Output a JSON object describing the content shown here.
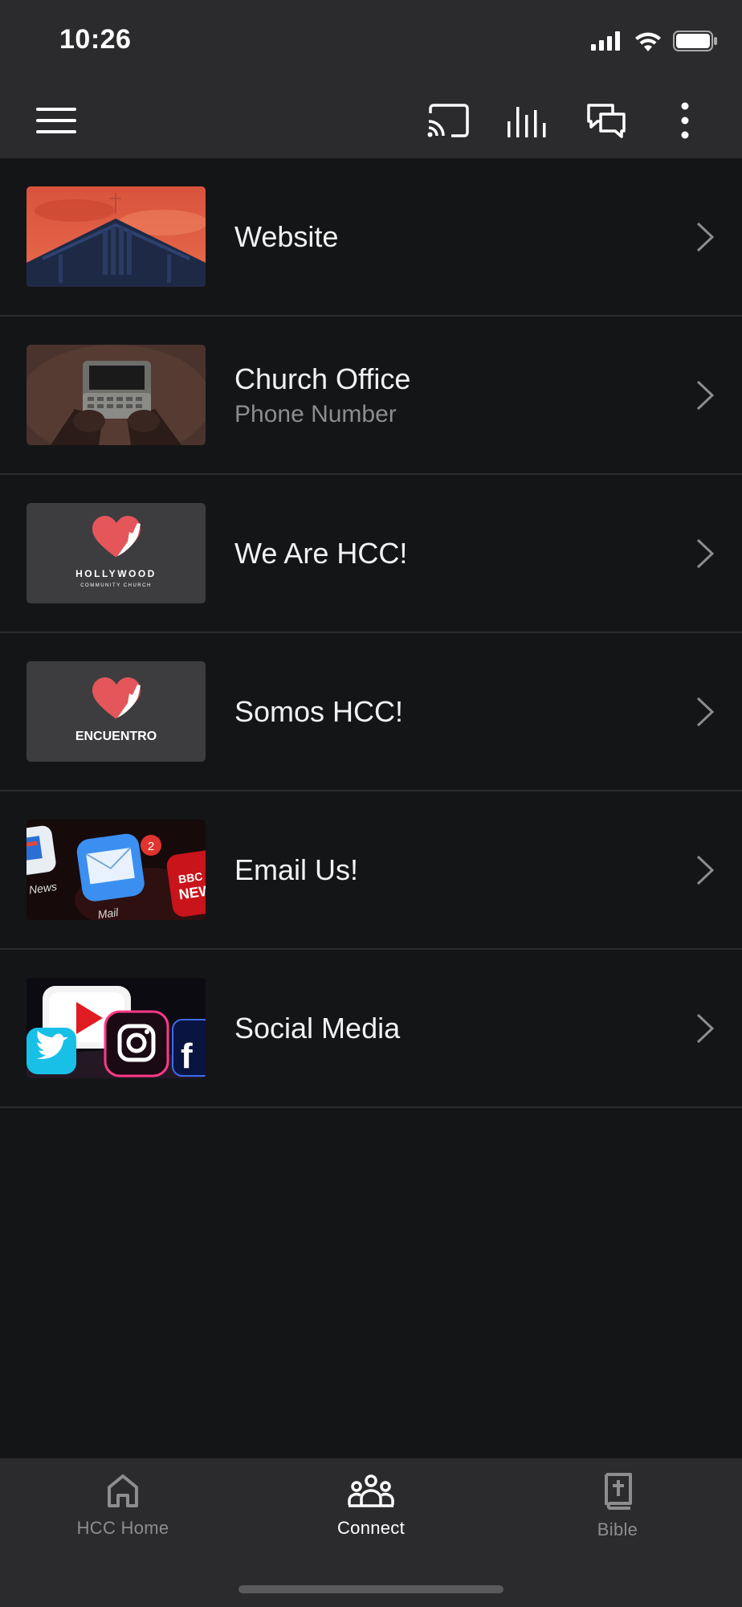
{
  "status_bar": {
    "time": "10:26"
  },
  "toolbar": {
    "menu_icon": "hamburger-icon",
    "cast_icon": "cast-icon",
    "audio_icon": "equalizer-icon",
    "chat_icon": "chat-icon",
    "more_icon": "more-vertical-icon"
  },
  "list": {
    "items": [
      {
        "title": "Website",
        "subtitle": "",
        "thumbnail": "church-building-sunset"
      },
      {
        "title": "Church Office",
        "subtitle": "Phone Number",
        "thumbnail": "hands-holding-phone"
      },
      {
        "title": "We Are HCC!",
        "subtitle": "",
        "thumbnail": "hollywood-community-church-logo",
        "logo_text": "HOLLYWOOD",
        "logo_subtext": "COMMUNITY CHURCH"
      },
      {
        "title": "Somos HCC!",
        "subtitle": "",
        "thumbnail": "encuentro-logo",
        "logo_text": "ENCUENTRO"
      },
      {
        "title": "Email Us!",
        "subtitle": "",
        "thumbnail": "mail-app-icons",
        "mail_badge": "2",
        "news_label": "News",
        "mail_label": "Mail",
        "bbc_label": "BBC",
        "bbc_news": "NEW"
      },
      {
        "title": "Social Media",
        "subtitle": "",
        "thumbnail": "social-media-icons"
      }
    ]
  },
  "bottom_nav": {
    "items": [
      {
        "label": "HCC Home",
        "icon": "home-icon",
        "active": false
      },
      {
        "label": "Connect",
        "icon": "people-icon",
        "active": true
      },
      {
        "label": "Bible",
        "icon": "bible-icon",
        "active": false
      }
    ]
  },
  "colors": {
    "background": "#141517",
    "bar": "#2b2b2d",
    "brand_red": "#e4565a",
    "inactive": "#8d8d90",
    "active": "#ffffff"
  }
}
